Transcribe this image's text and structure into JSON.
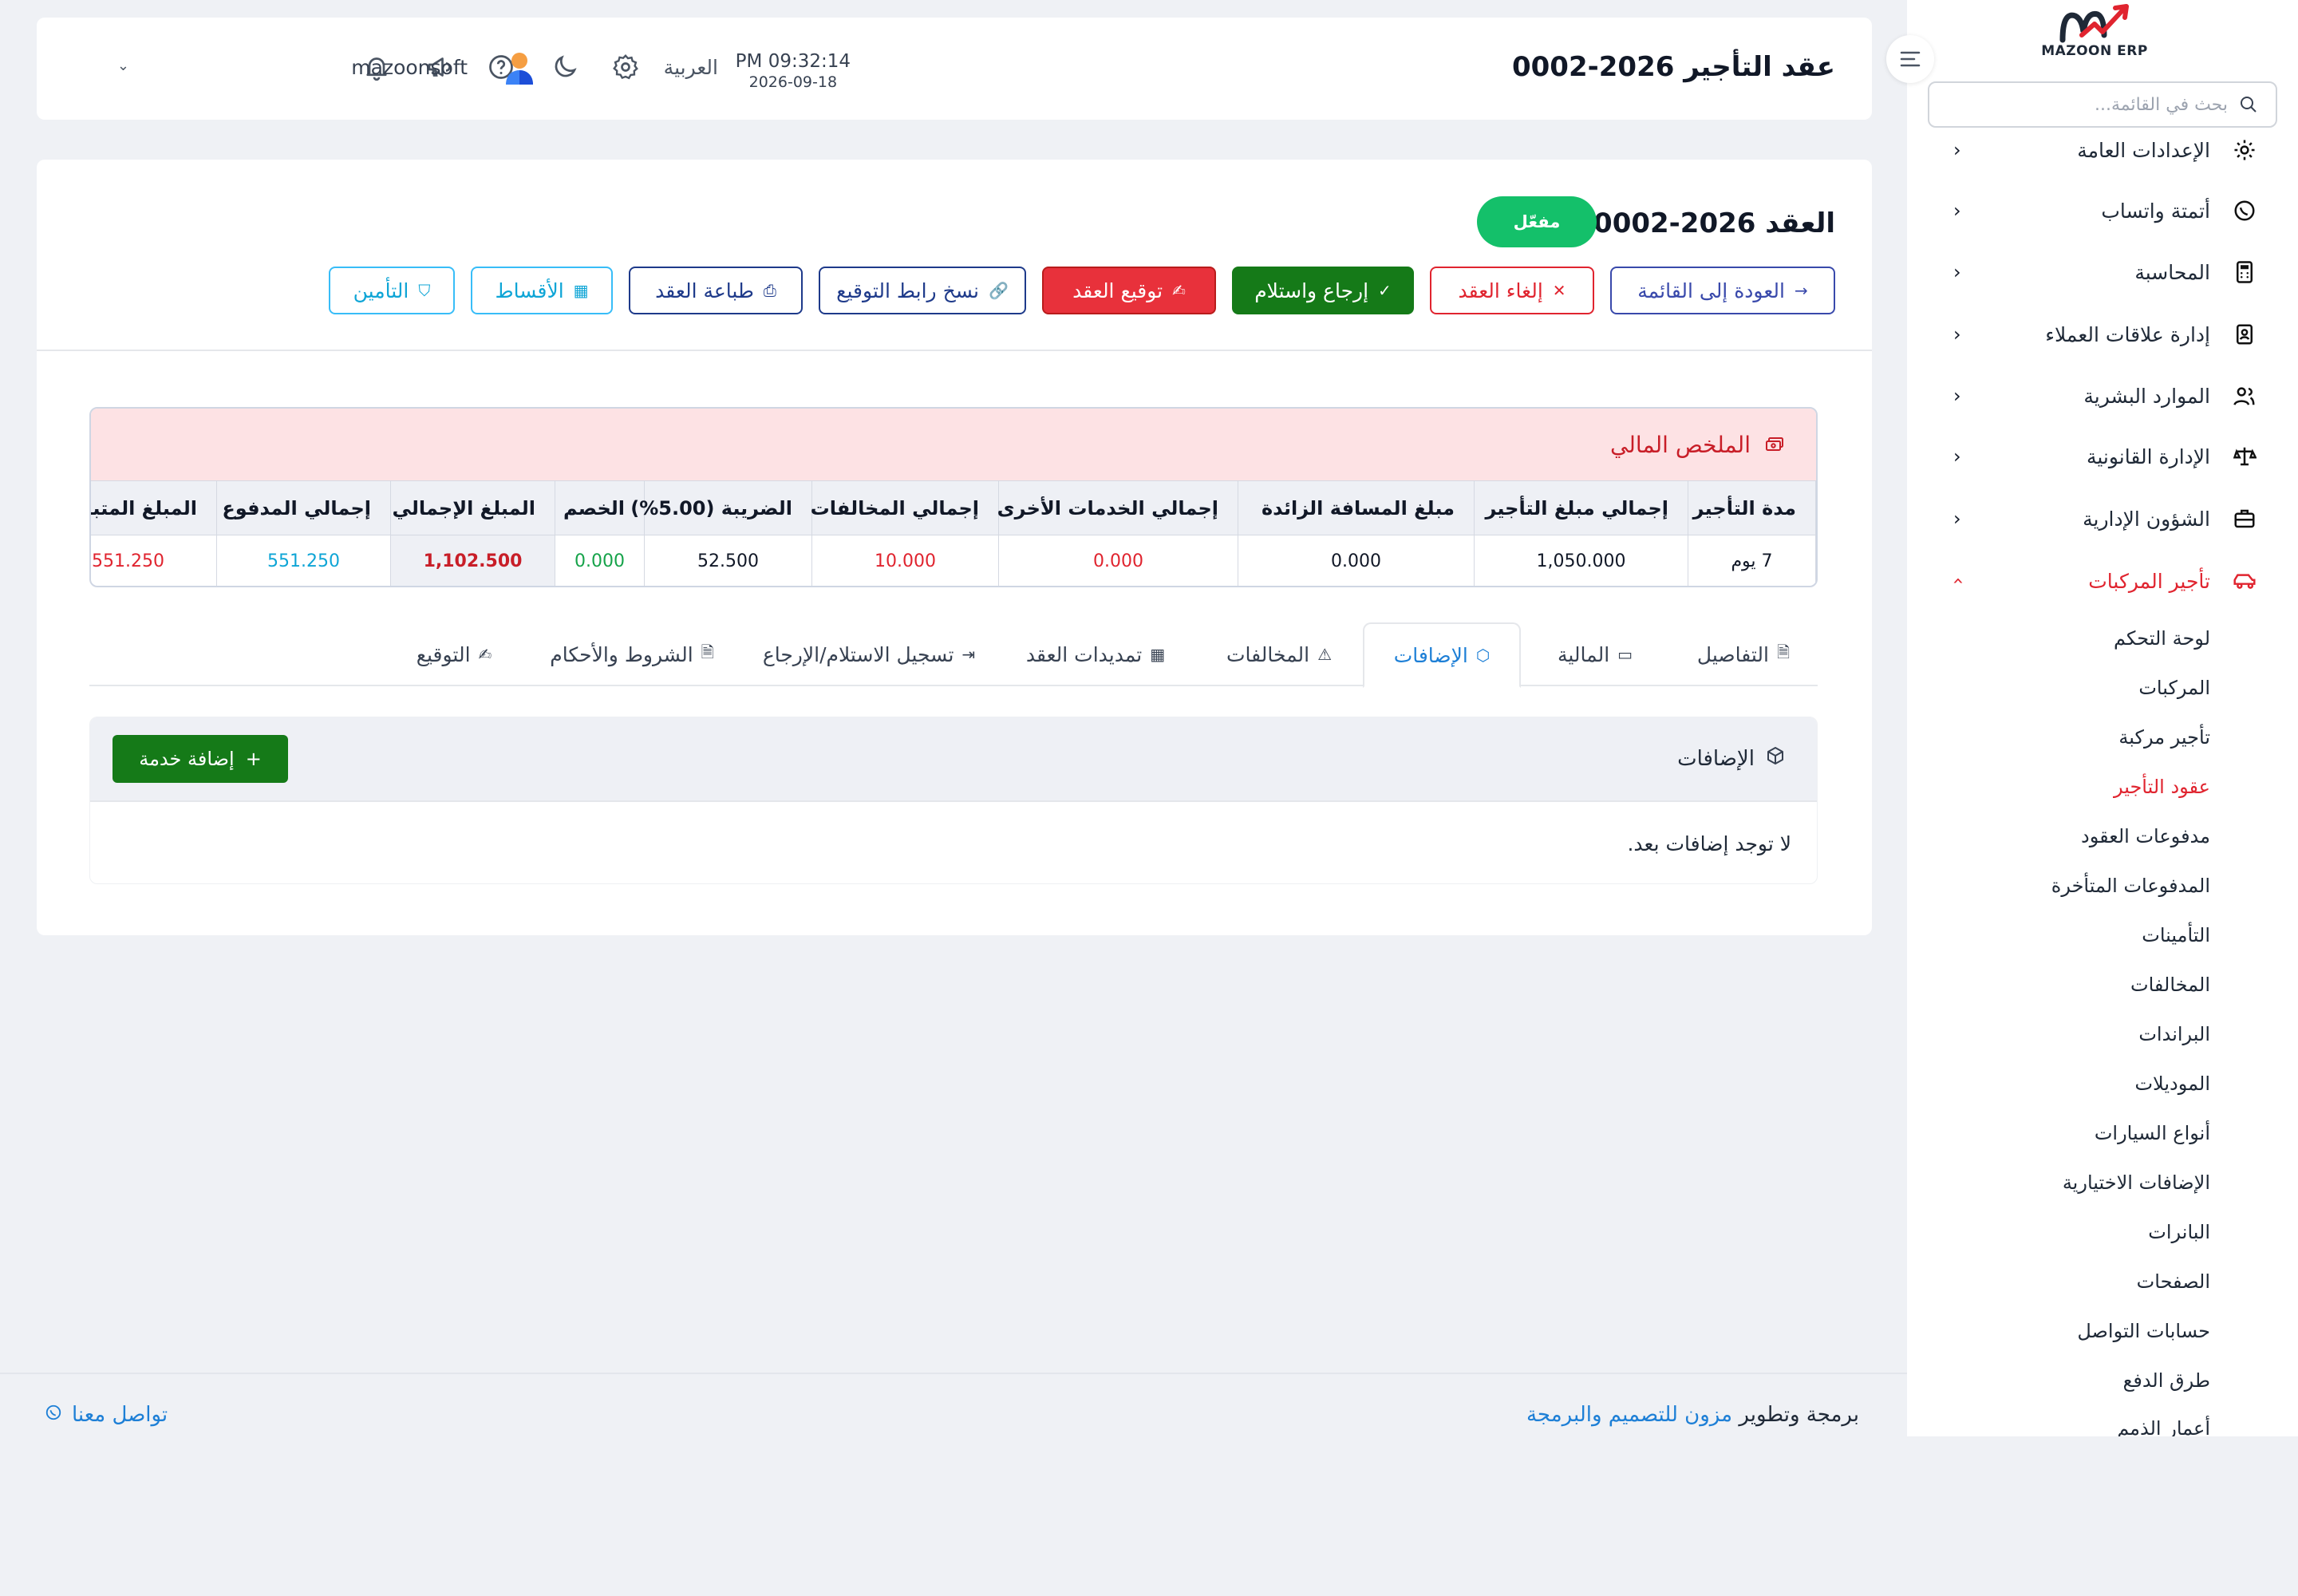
{
  "sidebar": {
    "logo_text": "MAZOON ERP",
    "search_placeholder": "بحث في القائمة...",
    "menu": [
      {
        "label": "الإعدادات العامة",
        "icon": "gear-icon"
      },
      {
        "label": "أتمتة واتساب",
        "icon": "whatsapp-icon"
      },
      {
        "label": "المحاسبة",
        "icon": "calculator-icon"
      },
      {
        "label": "إدارة علاقات العملاء",
        "icon": "contacts-icon"
      },
      {
        "label": "الموارد البشرية",
        "icon": "users-icon"
      },
      {
        "label": "الإدارة القانونية",
        "icon": "scale-icon"
      },
      {
        "label": "الشؤون الإدارية",
        "icon": "briefcase-icon"
      },
      {
        "label": "تأجير المركبات",
        "icon": "car-icon"
      }
    ],
    "submenu": [
      "لوحة التحكم",
      "المركبات",
      "تأجير مركبة",
      "عقود التأجير",
      "مدفوعات العقود",
      "المدفوعات المتأخرة",
      "التأمينات",
      "المخالفات",
      "البراندات",
      "الموديلات",
      "أنواع السيارات",
      "الإضافات الاختيارية",
      "البانرات",
      "الصفحات",
      "حسابات التواصل",
      "طرق الدفع",
      "أعمار الذمم"
    ],
    "active_submenu_index": 3
  },
  "topbar": {
    "title": "عقد التأجير 2026-0002",
    "time": "PM 09:32:14",
    "date": "2026-09-18",
    "language": "العربية",
    "username": "mazoonsoft"
  },
  "contract": {
    "title": "العقد 2026-0002",
    "status": "مفعّل",
    "actions": {
      "back": "العودة إلى القائمة",
      "cancel": "إلغاء العقد",
      "return": "إرجاع واستلام",
      "sign": "توقيع العقد",
      "copy_link": "نسخ رابط التوقيع",
      "print": "طباعة العقد",
      "installments": "الأقساط",
      "insurance": "التأمين"
    }
  },
  "financial_summary": {
    "title": "الملخص المالي",
    "columns": [
      "مدة التأجير",
      "إجمالي مبلغ التأجير",
      "مبلغ المسافة الزائدة",
      "إجمالي الخدمات الأخرى",
      "إجمالي المخالفات",
      "الضريبة (5.00%)",
      "الخصم",
      "المبلغ الإجمالي",
      "إجمالي المدفوع",
      "المبلغ المتبقي"
    ],
    "values": [
      "7 يوم",
      "1,050.000",
      "0.000",
      "0.000",
      "10.000",
      "52.500",
      "0.000",
      "1,102.500",
      "551.250",
      "551.250"
    ],
    "value_colors": [
      "#111827",
      "#111827",
      "#111827",
      "#e0242f",
      "#e0242f",
      "#111827",
      "#16a34a",
      "#c81e28",
      "#0ea5d6",
      "#e0242f"
    ]
  },
  "tabs": [
    {
      "label": "التفاصيل",
      "icon": "document-icon"
    },
    {
      "label": "المالية",
      "icon": "money-icon"
    },
    {
      "label": "الإضافات",
      "icon": "box-icon"
    },
    {
      "label": "المخالفات",
      "icon": "warning-icon"
    },
    {
      "label": "تمديدات العقد",
      "icon": "calendar-icon"
    },
    {
      "label": "تسجيل الاستلام/الإرجاع",
      "icon": "exit-icon"
    },
    {
      "label": "الشروط والأحكام",
      "icon": "document-icon"
    },
    {
      "label": "التوقيع",
      "icon": "signature-icon"
    }
  ],
  "active_tab_index": 2,
  "additions": {
    "title": "الإضافات",
    "add_button": "إضافة خدمة",
    "empty_message": "لا توجد إضافات بعد."
  },
  "footer": {
    "credit_prefix": "برمجة وتطوير",
    "credit_brand": "مزون للتصميم والبرمجة",
    "contact": "تواصل معنا"
  },
  "colors": {
    "accent_red": "#e0242f",
    "success_green": "#14c06a",
    "action_green": "#157a18",
    "link_blue": "#1d7fd6",
    "indigo": "#3949ab"
  }
}
